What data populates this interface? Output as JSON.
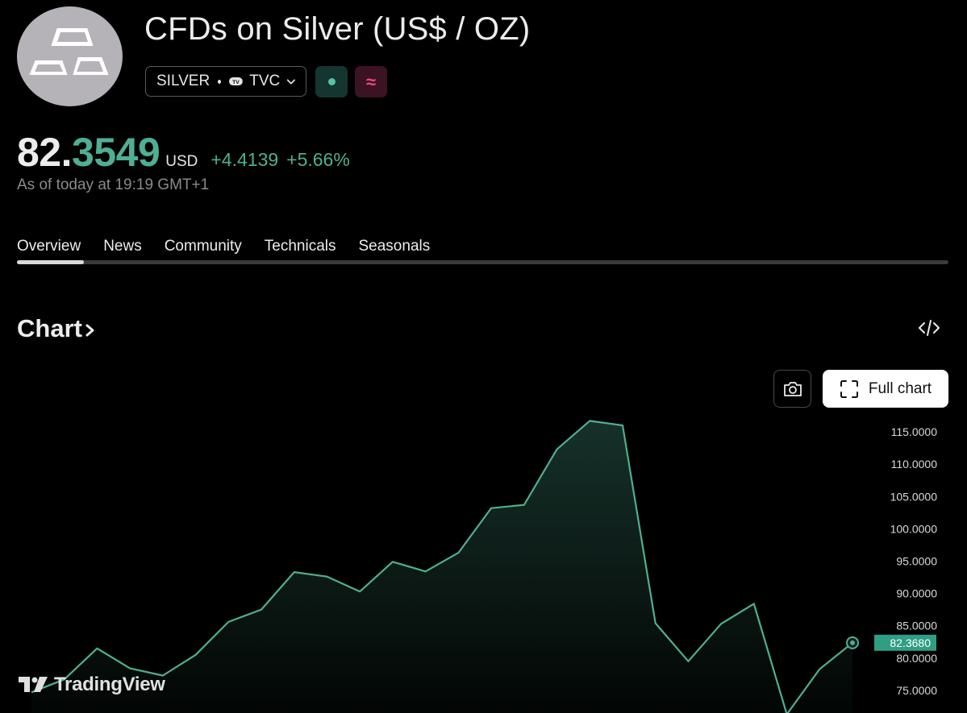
{
  "header": {
    "logo_icon": "silver-bars-icon",
    "title": "CFDs on Silver (US$ / OZ)",
    "symbol": "SILVER",
    "exchange": "TVC",
    "market_status_color": "#55c3a6",
    "delayed_icon": "≈"
  },
  "quote": {
    "price_int": "82.",
    "price_dec": "3549",
    "currency": "USD",
    "change": "+4.4139",
    "change_pct": "+5.66%",
    "as_of": "As of today at 19:19 GMT+1",
    "accent_color": "#4fae93"
  },
  "tabs": [
    {
      "label": "Overview",
      "active": true
    },
    {
      "label": "News"
    },
    {
      "label": "Community"
    },
    {
      "label": "Technicals"
    },
    {
      "label": "Seasonals"
    }
  ],
  "chart_section": {
    "heading": "Chart",
    "full_chart_label": "Full chart"
  },
  "chart_data": {
    "type": "area",
    "y_ticks": [
      115,
      110,
      105,
      100,
      95,
      90,
      85,
      80,
      75
    ],
    "y_tick_labels": [
      "115.0000",
      "110.0000",
      "105.0000",
      "100.0000",
      "95.0000",
      "90.0000",
      "85.0000",
      "80.0000",
      "75.0000"
    ],
    "ylim": [
      71.5,
      117
    ],
    "values": [
      74.7,
      76.7,
      81.5,
      78.4,
      77.3,
      80.5,
      85.6,
      87.5,
      93.3,
      92.6,
      90.3,
      94.9,
      93.4,
      96.3,
      103.2,
      103.7,
      112.3,
      116.7,
      116.0,
      85.4,
      79.5,
      85.3,
      88.4,
      71.3,
      78.3,
      82.368
    ],
    "last_value_label": "82.3680",
    "line_color": "#4fae93",
    "grid": false
  },
  "branding": {
    "name": "TradingView"
  }
}
